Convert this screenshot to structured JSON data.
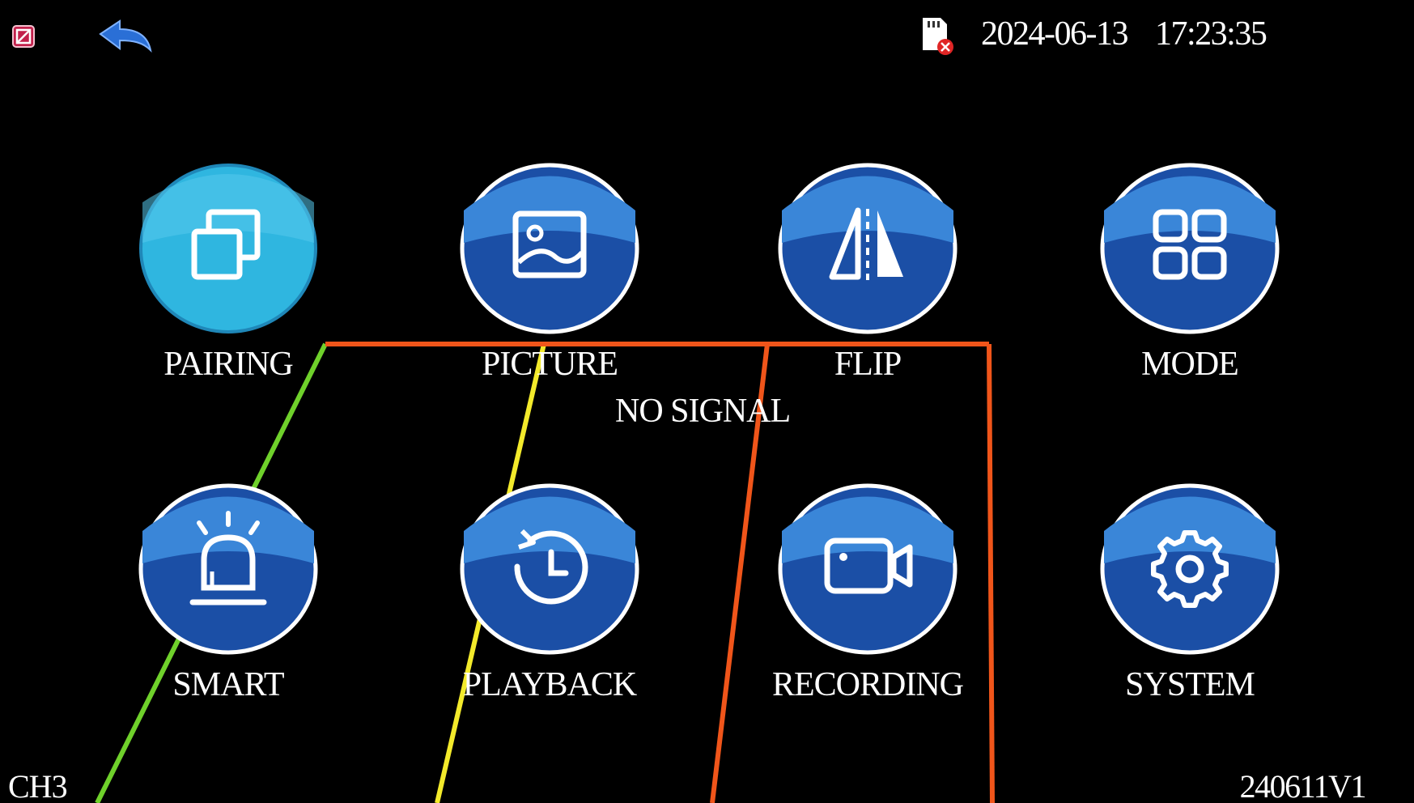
{
  "header": {
    "date": "2024-06-13",
    "time": "17:23:35"
  },
  "menu": {
    "pairing": "PAIRING",
    "picture": "PICTURE",
    "flip": "FLIP",
    "mode": "MODE",
    "smart": "SMART",
    "playback": "PLAYBACK",
    "recording": "RECORDING",
    "system": "SYSTEM"
  },
  "status": {
    "no_signal": "NO SIGNAL",
    "channel": "CH3",
    "version": "240611V1"
  },
  "icons": {
    "exit": "exit-icon",
    "back": "back-arrow-icon",
    "sd_card": "sd-card-error-icon"
  },
  "colors": {
    "button_blue": "#1b4fa6",
    "button_selected": "#2fb6e0",
    "guide_green": "#6fd12b",
    "guide_yellow": "#f3ea2b",
    "guide_red": "#f0551a"
  }
}
